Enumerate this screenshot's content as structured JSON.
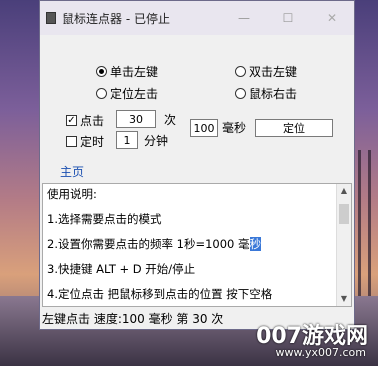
{
  "window": {
    "title": "鼠标连点器 - 已停止"
  },
  "options": {
    "single_left": "单击左键",
    "double_left": "双击左键",
    "locate_left": "定位左击",
    "mouse_right": "鼠标右击",
    "click_label": "点击",
    "click_count": "30",
    "click_unit": "次",
    "timer_label": "定时",
    "timer_value": "1",
    "timer_unit": "分钟",
    "interval_value": "100",
    "interval_unit": "毫秒",
    "locate_button": "定位"
  },
  "tab": {
    "home": "主页"
  },
  "help": {
    "line1": "使用说明:",
    "line2": "1.选择需要点击的模式",
    "line3a": "2.设置你需要点击的频率 1秒=1000 毫",
    "line3b": "秒",
    "line4": "3.快捷键 ALT + D 开始/停止",
    "line5": "4.定位点击 把鼠标移到点击的位置 按下空格"
  },
  "status": {
    "text": "左键点击 速度:100 毫秒 第 30 次"
  },
  "watermark": {
    "brand": "007游戏网",
    "url": "www.yx007.com"
  }
}
